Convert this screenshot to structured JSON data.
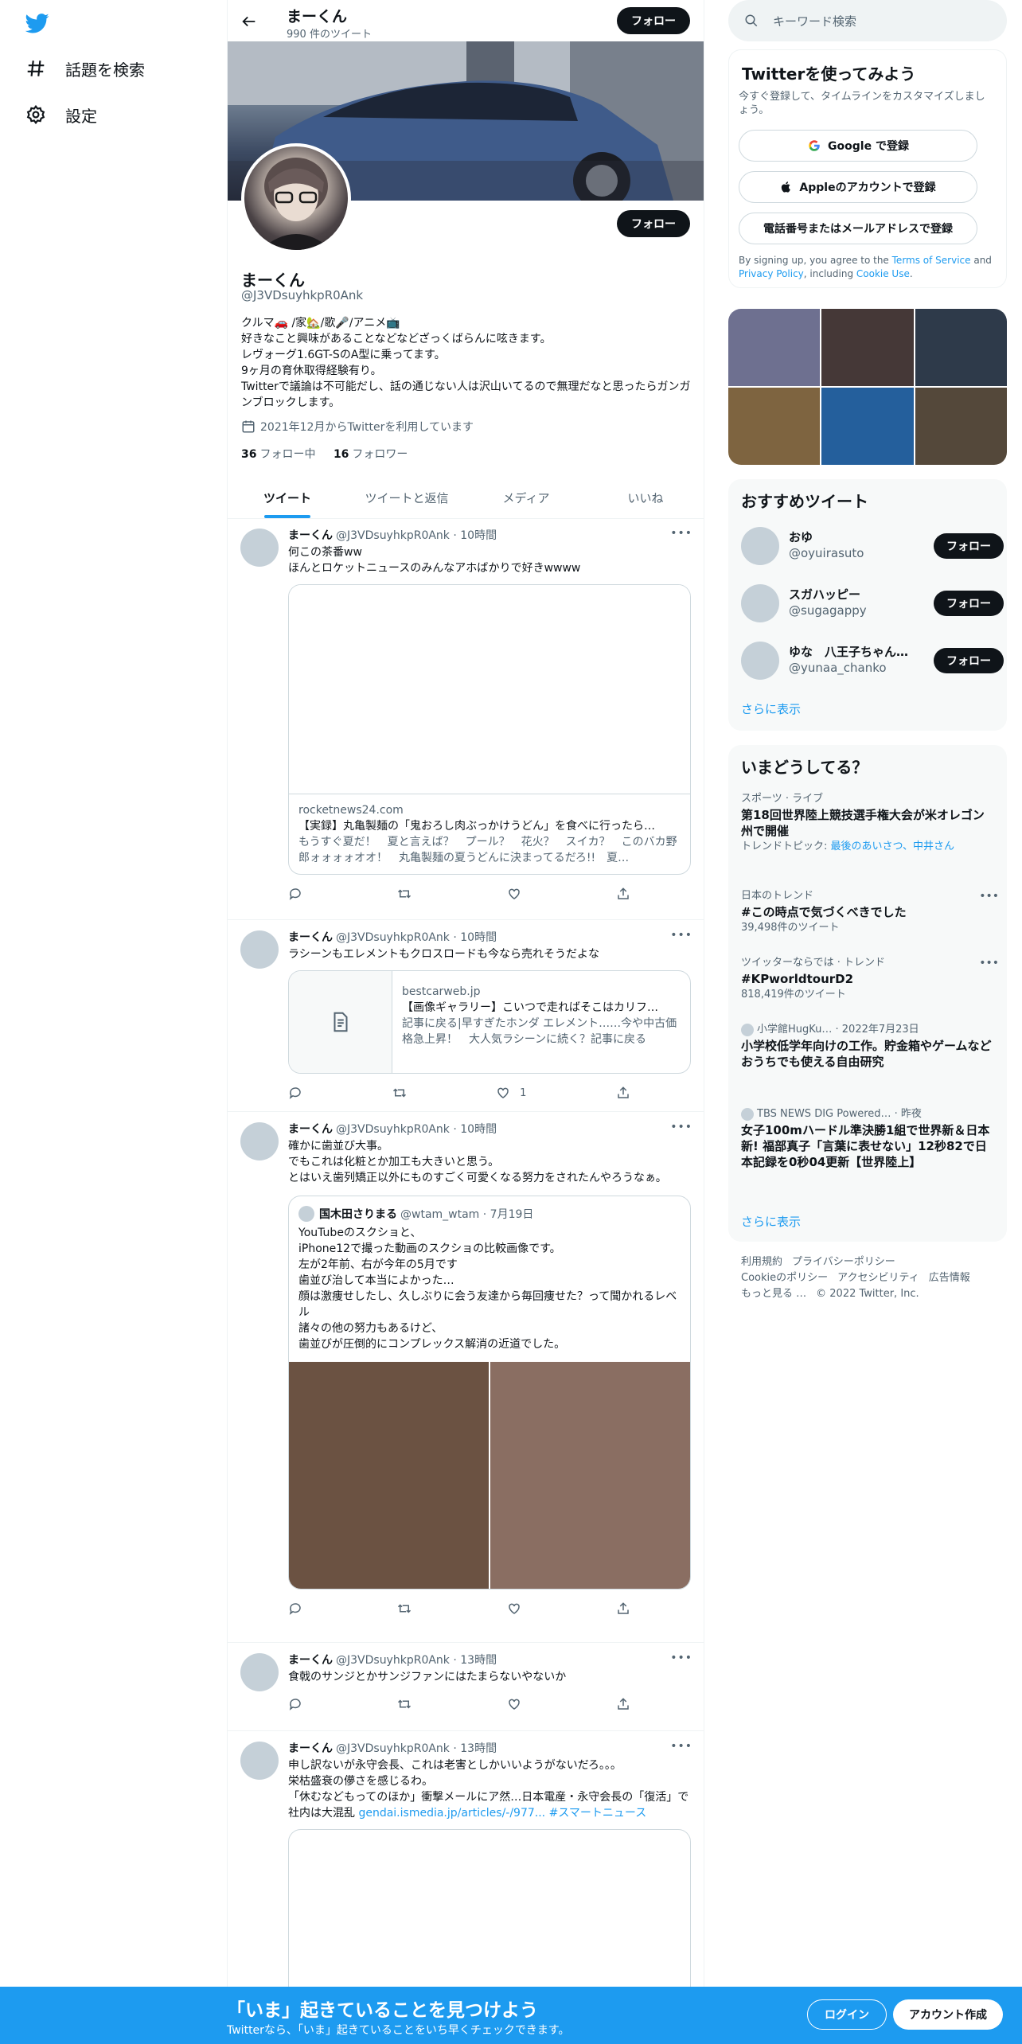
{
  "sidebar": {
    "items": [
      {
        "label": "話題を検索"
      },
      {
        "label": "設定"
      }
    ]
  },
  "header": {
    "name": "まーくん",
    "count": "990 件のツイート",
    "follow": "フォロー"
  },
  "profile": {
    "name": "まーくん",
    "handle": "@J3VDsuyhkpR0Ank",
    "follow": "フォロー",
    "bio": "クルマ🚗 /家🏡/歌🎤/アニメ📺\n好きなこと興味があることなどなどざっくばらんに呟きます。\nレヴォーグ1.6GT-SのA型に乗ってます。\n9ヶ月の育休取得経験有り。\nTwitterで議論は不可能だし、話の通じない人は沢山いてるので無理だなと思ったらガンガンブロックします。",
    "joined": "2021年12月からTwitterを利用しています",
    "following_count": "36",
    "following_label": "フォロー中",
    "followers_count": "16",
    "followers_label": "フォロワー"
  },
  "tabs": [
    {
      "label": "ツイート"
    },
    {
      "label": "ツイートと返信"
    },
    {
      "label": "メディア"
    },
    {
      "label": "いいね"
    }
  ],
  "tweets": [
    {
      "name": "まーくん",
      "meta": "@J3VDsuyhkpR0Ank · 10時間",
      "text": "何この茶番ww\nほんとロケットニュースのみんなアホばかりで好きwwww",
      "card_domain": "rocketnews24.com",
      "card_title": "【実録】丸亀製麺の「鬼おろし肉ぶっかけうどん」を食べに行ったら…",
      "card_desc": "もうすぐ夏だ！　夏と言えば？　プール？　花火？　スイカ？　このバカ野郎ォォォォオオ！　丸亀製麺の夏うどんに決まってるだろ!!　夏…"
    },
    {
      "name": "まーくん",
      "meta": "@J3VDsuyhkpR0Ank · 10時間",
      "text": "ラシーンもエレメントもクロスロードも今なら売れそうだよな",
      "card_domain": "bestcarweb.jp",
      "card_title": "【画像ギャラリー】こいつで走ればそこはカリフ…",
      "card_desc": "記事に戻る|早すぎたホンダ エレメント……今や中古価格急上昇！　大人気ラシーンに続く？記事に戻る",
      "like_count": "1"
    },
    {
      "name": "まーくん",
      "meta": "@J3VDsuyhkpR0Ank · 10時間",
      "text": "確かに歯並び大事。\nでもこれは化粧とか加工も大きいと思う。\nとはいえ歯列矯正以外にものすごく可愛くなる努力をされたんやろうなぁ。",
      "quote_name": "国木田さりまる",
      "quote_meta": "@wtam_wtam · 7月19日",
      "quote_text": "YouTubeのスクショと、\niPhone12で撮った動画のスクショの比較画像です。\n左が2年前、右が今年の5月です\n歯並び治して本当によかった…\n顔は激痩せしたし、久しぶりに会う友達から毎回痩せた？って聞かれるレベル\n諸々の他の努力もあるけど、\n歯並びが圧倒的にコンプレックス解消の近道でした。"
    },
    {
      "name": "まーくん",
      "meta": "@J3VDsuyhkpR0Ank · 13時間",
      "text": "食戟のサンジとかサンジファンにはたまらないやないか"
    },
    {
      "name": "まーくん",
      "meta": "@J3VDsuyhkpR0Ank · 13時間",
      "text": "申し訳ないが永守会長、これは老害としかいいようがないだろ。。。\n栄枯盛衰の儚さを感じるわ。\n「休むなどもってのほか」衝撃メールにア然…日本電産・永守会長の「復活」で社内は大混乱 ",
      "link": "gendai.ismedia.jp/articles/-/977...",
      "hashtag": " #スマートニュース"
    }
  ],
  "right": {
    "search_placeholder": "キーワード検索",
    "signup": {
      "title": "Twitterを使ってみよう",
      "sub": "今すぐ登録して、タイムラインをカスタマイズしましょう。",
      "google": "Google で登録",
      "apple": "Appleのアカウントで登録",
      "phone": "電話番号またはメールアドレスで登録",
      "terms_a": "By signing up, you agree to the ",
      "terms_link": "Terms of Service",
      "terms_and": " and ",
      "privacy": "Privacy Policy",
      "including": ", including ",
      "cookie": "Cookie Use",
      "dot": "."
    },
    "recommended": {
      "title": "おすすめツイート",
      "users": [
        {
          "name": "おゆ",
          "handle": "@oyuirasuto",
          "btn": "フォロー"
        },
        {
          "name": "スガハッピー",
          "handle": "@sugagappy",
          "btn": "フォロー"
        },
        {
          "name": "ゆな　八王子ちゃん…",
          "handle": "@yunaa_chanko",
          "btn": "フォロー"
        }
      ],
      "more": "さらに表示"
    },
    "trends": {
      "title": "いまどうしてる？",
      "items": [
        {
          "cat": "スポーツ · ライブ",
          "name": "第18回世界陸上競技選手権大会が米オレゴン州で開催",
          "extra_label": "トレンドトピック: ",
          "extra_link": "最後のあいさつ、中井さん"
        },
        {
          "cat": "日本のトレンド",
          "name": "#この時点で気づくべきでした",
          "extra": "39,498件のツイート"
        },
        {
          "cat": "ツイッターならでは · トレンド",
          "name": "#KPworldtourD2",
          "extra": "818,419件のツイート"
        },
        {
          "cat": "小学館HugKu… · 2022年7月23日",
          "name": "小学校低学年向けの工作。貯金箱やゲームなどおうちでも使える自由研究"
        },
        {
          "cat": "TBS NEWS DIG Powered… · 昨夜",
          "name": "女子100mハードル準決勝1組で世界新＆日本新! 福部真子「言葉に表せない」12秒82で日本記録を0秒04更新【世界陸上】"
        }
      ],
      "more": "さらに表示"
    },
    "footer": {
      "l1": "利用規約",
      "l2": "プライバシーポリシー",
      "l3": "Cookieのポリシー",
      "l4": "アクセシビリティ",
      "l5": "広告情報",
      "l6": "もっと見る …",
      "copy": "© 2022 Twitter, Inc."
    }
  },
  "bottom": {
    "title": "「いま」起きていることを見つけよう",
    "sub": "Twitterなら、「いま」起きていることをいち早くチェックできます。",
    "login": "ログイン",
    "signup": "アカウント作成"
  },
  "colors": {
    "accent": "#1d9bf0",
    "text": "#0f1419",
    "muted": "#536471"
  },
  "icons": [
    "twitter-logo-icon",
    "hashtag-icon",
    "gear-icon",
    "back-arrow-icon",
    "calendar-icon",
    "reply-icon",
    "retweet-icon",
    "like-icon",
    "share-icon",
    "search-icon",
    "google-icon",
    "apple-icon",
    "article-icon",
    "verified-icon"
  ]
}
